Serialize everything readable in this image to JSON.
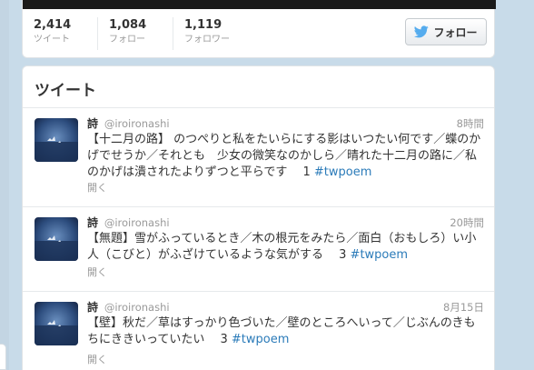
{
  "profile": {
    "stats": [
      {
        "value": "2,414",
        "label": "ツイート"
      },
      {
        "value": "1,084",
        "label": "フォロー"
      },
      {
        "value": "1,119",
        "label": "フォロワー"
      }
    ],
    "follow_button": "フォロー",
    "follow_icon": "twitter-bird-icon"
  },
  "stream": {
    "title": "ツイート",
    "tweets": [
      {
        "name": "詩",
        "handle": "@iroironashi",
        "time": "8時間",
        "text": "【十二月の路】 のつぺりと私をたいらにする影はいつたい何です／蝶のかげでせうか／それとも　少女の微笑なのかしら／晴れた十二月の路に／私のかげは潰されたよりずつと平らです　 1 ",
        "hashtag": "#twpoem",
        "expand": "開く"
      },
      {
        "name": "詩",
        "handle": "@iroironashi",
        "time": "20時間",
        "text": "【無題】雪がふっているとき／木の根元をみたら／面白（おもしろ）い小人（こびと）がふざけているような気がする　 3 ",
        "hashtag": "#twpoem",
        "expand": "開く"
      },
      {
        "name": "詩",
        "handle": "@iroironashi",
        "time": "8月15日",
        "text": "【壁】秋だ／草はすっかり色づいた／壁のところへいって／じぶんのきもちにききいっていたい　 3 ",
        "hashtag": "#twpoem",
        "expand": "開く"
      }
    ]
  },
  "colors": {
    "link": "#2b7bb9",
    "background": "#c8dbe9",
    "twitter_blue": "#55acee"
  }
}
